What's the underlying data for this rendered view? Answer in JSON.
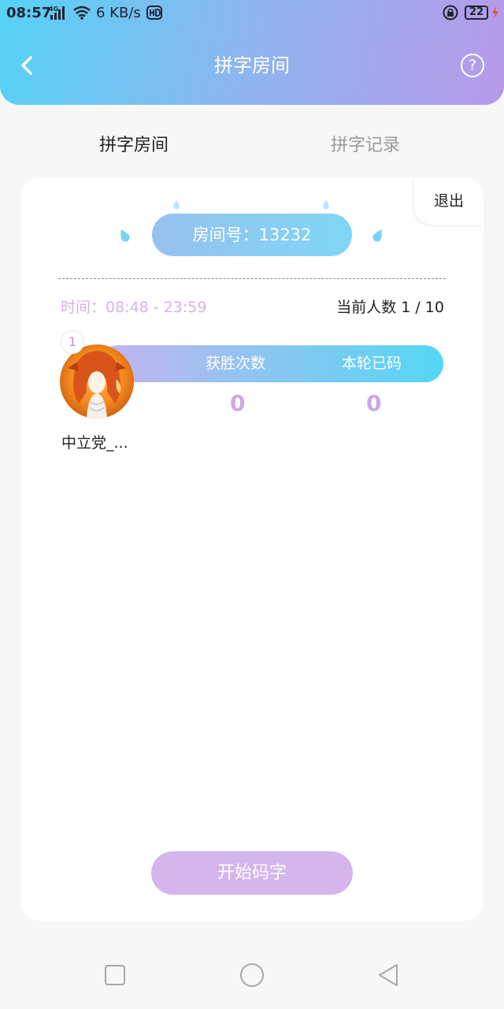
{
  "status_bar": {
    "time": "08:57",
    "signal_label": "4G",
    "net_speed": "6 KB/s",
    "battery": "22",
    "icons": [
      "signal-icon",
      "wifi-icon",
      "hd-icon",
      "lock-icon",
      "battery-icon",
      "charging-icon"
    ]
  },
  "header": {
    "title": "拼字房间",
    "back_icon": "chevron-left-icon",
    "help_label": "?"
  },
  "tabs": [
    {
      "label": "拼字房间",
      "active": true
    },
    {
      "label": "拼字记录",
      "active": false
    }
  ],
  "room": {
    "exit_label": "退出",
    "room_number_label": "房间号：13232",
    "time_label": "时间：08:48 - 23:59",
    "people_label": "当前人数 1 / 10",
    "columns": {
      "wins": "获胜次数",
      "typed": "本轮已码"
    },
    "players": [
      {
        "rank": "1",
        "name": "中立党_...",
        "wins": "0",
        "typed": "0"
      }
    ],
    "start_label": "开始码字"
  },
  "colors": {
    "header_gradient_start": "#55d2f4",
    "header_gradient_end": "#b79ae9",
    "accent_purple": "#d4b5ec",
    "time_text": "#d3b4e6"
  },
  "system_nav": [
    "square-recent-icon",
    "circle-home-icon",
    "triangle-back-icon"
  ]
}
